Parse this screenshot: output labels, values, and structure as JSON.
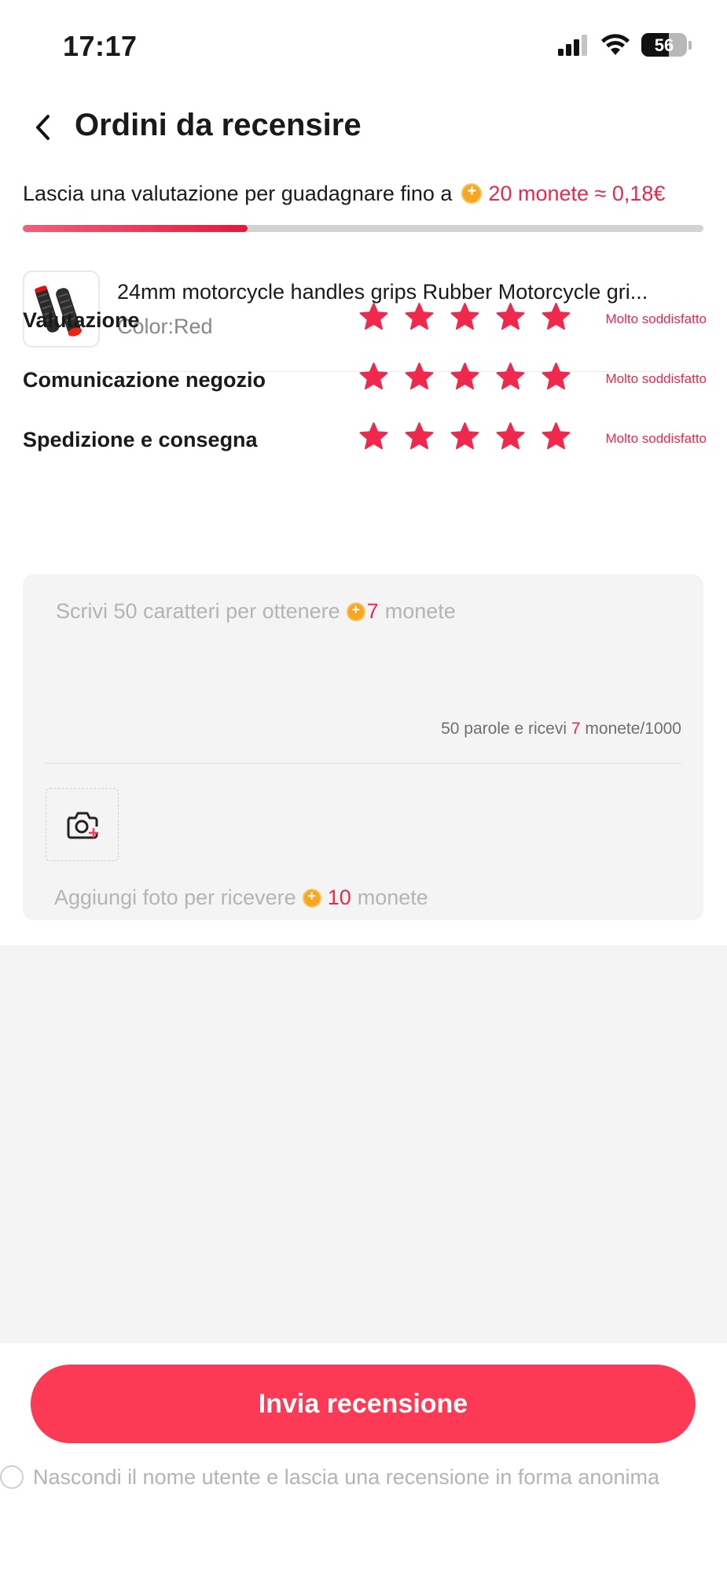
{
  "status_bar": {
    "time": "17:17",
    "battery": "56"
  },
  "header": {
    "title": "Ordini da recensire"
  },
  "reward": {
    "text": "Lascia una valutazione per guadagnare fino a",
    "amount": "20 monete ≈ 0,18€",
    "progress": 0.33
  },
  "product": {
    "name": "24mm motorcycle handles grips Rubber Motorcycle gri...",
    "variant": "Color:Red"
  },
  "ratings": [
    {
      "label": "Valutazione",
      "stars": 5,
      "description": "Molto soddisfatto"
    },
    {
      "label": "Comunicazione negozio",
      "stars": 5,
      "description": "Molto soddisfatto"
    },
    {
      "label": "Spedizione e consegna",
      "stars": 5,
      "description": "Molto soddisfatto"
    }
  ],
  "review": {
    "placeholder_prefix": "Scrivi 50 caratteri per ottenere",
    "placeholder_coins": "7",
    "placeholder_suffix": "monete",
    "counter_prefix": "50 parole e ricevi",
    "counter_coins": "7",
    "counter_suffix": "monete/1000"
  },
  "photo": {
    "hint_prefix": "Aggiungi foto per ricevere",
    "hint_coins": "10",
    "hint_suffix": "monete"
  },
  "footer": {
    "submit_label": "Invia recensione",
    "anonymous_label": "Nascondi il nome utente e lascia una recensione in forma anonima"
  },
  "colors": {
    "accent": "#fd3a56",
    "coin": "#f6a623",
    "star": "#f0284c",
    "background": "#f4f4f4"
  }
}
